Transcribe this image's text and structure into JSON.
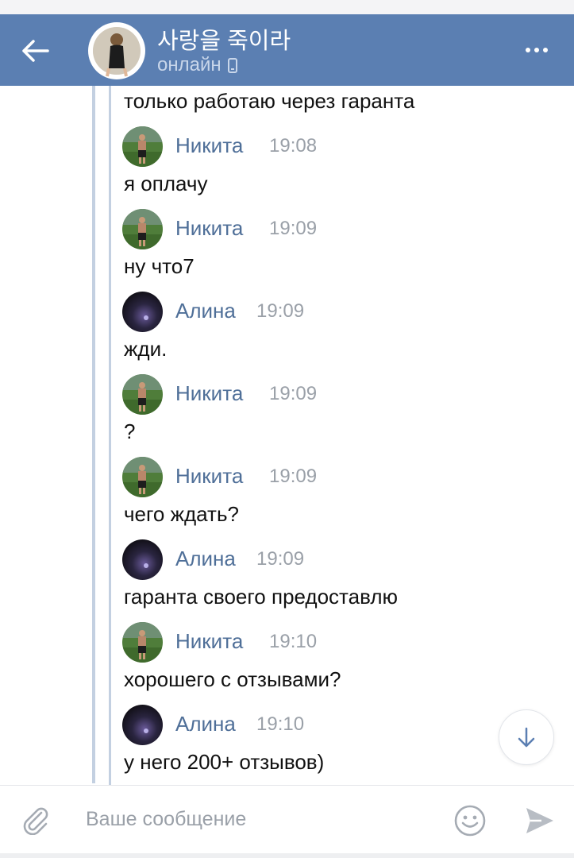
{
  "header": {
    "title": "사랑을 죽이라",
    "status": "онлайн",
    "back_icon": "arrow-left-icon",
    "more_icon": "more-dots-icon",
    "bg_color": "#5b7fb2"
  },
  "chat": {
    "first_text": "только работаю через гаранта",
    "messages": [
      {
        "author": "Никита",
        "time": "19:08",
        "text": "я оплачу"
      },
      {
        "author": "Никита",
        "time": "19:09",
        "text": "ну что7"
      },
      {
        "author": "Алина",
        "time": "19:09",
        "text": "жди."
      },
      {
        "author": "Никита",
        "time": "19:09",
        "text": "?"
      },
      {
        "author": "Никита",
        "time": "19:09",
        "text": "чего ждать?"
      },
      {
        "author": "Алина",
        "time": "19:09",
        "text": "гаранта своего предоставлю"
      },
      {
        "author": "Никита",
        "time": "19:10",
        "text": "хорошего с отзывами?"
      },
      {
        "author": "Алина",
        "time": "19:10",
        "text": "у него 200+ отзывов)"
      }
    ]
  },
  "composer": {
    "placeholder": "Ваше сообщение",
    "attach_icon": "paperclip-icon",
    "emoji_icon": "smiley-icon",
    "send_icon": "send-icon",
    "scroll_icon": "arrow-down-icon"
  }
}
